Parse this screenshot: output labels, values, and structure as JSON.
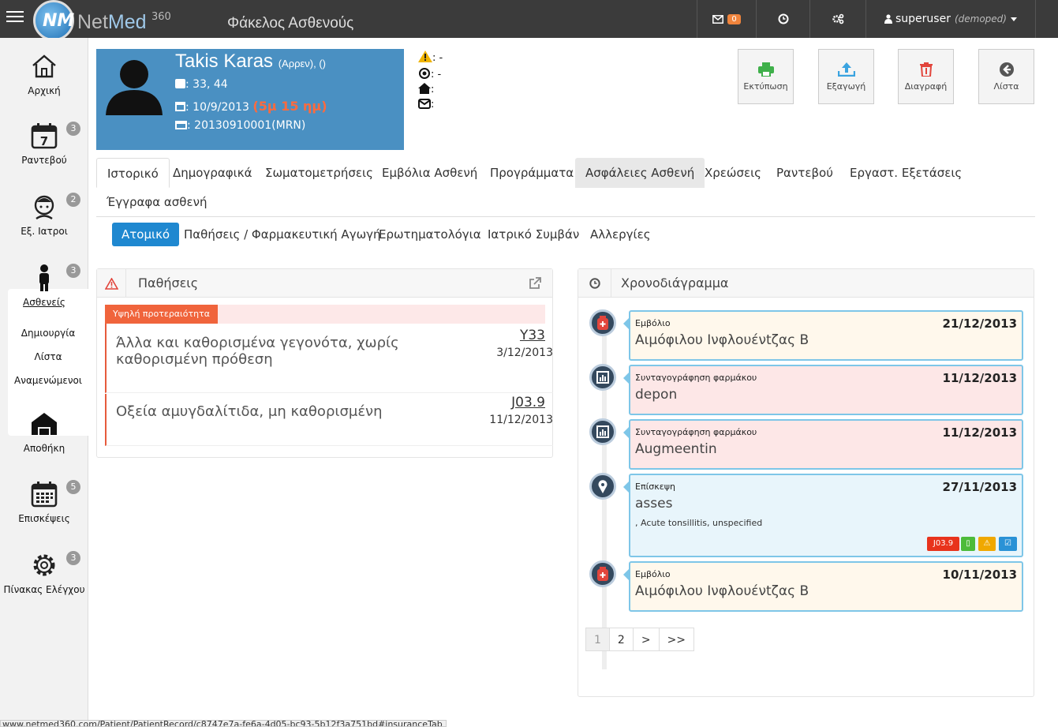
{
  "header": {
    "logo_text_a": "Net",
    "logo_text_b": "Med",
    "logo_sup": "360",
    "logo_mark": "NM",
    "title": "Φάκελος Ασθενούς",
    "mail_count": "0",
    "username": "superuser",
    "user_role": "(demoped)"
  },
  "sidebar": {
    "items": [
      {
        "label": "Αρχική",
        "badge": ""
      },
      {
        "label": "Ραντεβού",
        "badge": "3"
      },
      {
        "label": "Εξ. Ιατροι",
        "badge": "2"
      },
      {
        "label": "Ασθενείς",
        "badge": "3"
      },
      {
        "label": "Αποθήκη",
        "badge": ""
      },
      {
        "label": "Επισκέψεις",
        "badge": "5"
      },
      {
        "label": "Πίνακας Ελέγχου",
        "badge": "3"
      }
    ],
    "sub": [
      "Δημιουργία",
      "Λίστα",
      "Αναμενώμενοι"
    ],
    "calendar_day": "7"
  },
  "patient": {
    "name": "Takis Karas",
    "gender": "(Αρρεν), ()",
    "phone": ": 33, 44",
    "dob": ": 10/9/2013",
    "age": "(5μ 15 ημ)",
    "mrn": ": 20130910001(MRN)",
    "info": [
      ": -",
      ": -",
      ":",
      ":"
    ]
  },
  "actions": [
    "Εκτύπωση",
    "Εξαγωγή",
    "Διαγραφή",
    "Λίστα"
  ],
  "tabs": [
    "Ιστορικό",
    "Δημογραφικά",
    "Σωματομετρήσεις",
    "Εμβόλια Ασθενή",
    "Προγράμματα",
    "Ασφάλειες Ασθενή",
    "Χρεώσεις",
    "Ραντεβού",
    "Εργαστ. Εξετάσεις",
    "Έγγραφα ασθενή"
  ],
  "subtabs": [
    "Ατομικό",
    "Παθήσεις / Φαρμακευτική Αγωγή",
    "Ερωτηματολόγια",
    "Ιατρικό Συμβάν",
    "Αλλεργίες"
  ],
  "conditions": {
    "title": "Παθήσεις",
    "priority": "Υψηλή προτεραιότητα",
    "items": [
      {
        "text": "Άλλα και καθορισμένα γεγονότα, χωρίς καθορισμένη πρόθεση",
        "code": "Y33",
        "date": "3/12/2013"
      },
      {
        "text": "Οξεία αμυγδαλίτιδα, μη καθορισμένη",
        "code": "J03.9",
        "date": "11/12/2013"
      }
    ]
  },
  "timeline": {
    "title": "Χρονοδιάγραμμα",
    "items": [
      {
        "type": "Εμβόλιο",
        "date": "21/12/2013",
        "name": "Αιμόφιλου Ινφλουένtζας Β",
        "sub": ""
      },
      {
        "type": "Συνταγογράφηση φαρμάκου",
        "date": "11/12/2013",
        "name": "depon",
        "sub": ""
      },
      {
        "type": "Συνταγογράφηση φαρμάκου",
        "date": "11/12/2013",
        "name": "Augmeentin",
        "sub": ""
      },
      {
        "type": "Επίσκεψη",
        "date": "27/11/2013",
        "name": "asses",
        "sub": ", Acute tonsillitis, unspecified",
        "code": "J03.9"
      },
      {
        "type": "Εμβόλιο",
        "date": "10/11/2013",
        "name": "Αιμόφιλου Ινφλουένtζας Β",
        "sub": ""
      }
    ],
    "pager": [
      "1",
      "2",
      ">",
      ">>"
    ]
  },
  "status_url": "www.netmed360.com/Patient/PatientRecord/c8747e7a-fe6a-4d05-bc93-5b12f3a751bd#insuranceTab"
}
